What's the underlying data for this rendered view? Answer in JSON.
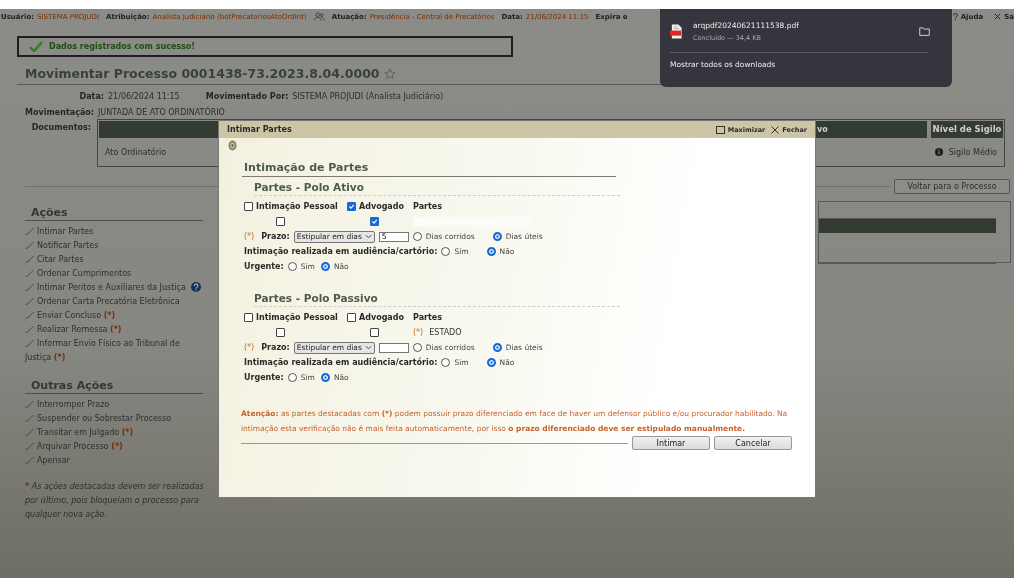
{
  "top_bar": {
    "fields": [
      {
        "label": "Usuário:",
        "value": "SISTEMA PROJUDI"
      },
      {
        "label": "Atribuição:",
        "value": "Analista Judiciário (botPrecatoriosAtoOrdInt)",
        "icon": true
      },
      {
        "label": "Atuação:",
        "value": "Presidência - Central de Precatórios"
      },
      {
        "label": "Data:",
        "value": "21/06/2024 11:15"
      },
      {
        "label": "Expira e"
      }
    ],
    "help": "Ajuda",
    "exit": "Sa"
  },
  "success_message": "Dados registrados com sucesso!",
  "page_title": "Movimentar Processo 0001438-73.2023.8.04.0000",
  "info": [
    {
      "label": "Data:",
      "value": "21/06/2024 11:15"
    },
    {
      "label": "Movimentado Por:",
      "value": "SISTEMA PROJUDI (Analista Judiciário)"
    }
  ],
  "movimentacao": {
    "label": "Movimentação:",
    "value": "JUNTADA DE ATO ORDINATÓRIO"
  },
  "documents": {
    "label": "Documentos:",
    "columns": [
      "vo",
      "Nível de Sigilo"
    ],
    "rows": [
      {
        "name": "Ato Ordinatório",
        "secrecy": "Sigilo Médio"
      }
    ]
  },
  "back_button": "Voltar para o Processo",
  "actions": {
    "title": "Ações",
    "items": [
      {
        "label": "Intimar Partes"
      },
      {
        "label": "Notificar Partes"
      },
      {
        "label": "Citar Partes"
      },
      {
        "label": "Ordenar Cumprimentos"
      },
      {
        "label": "Intimar Peritos e Auxiliares da Justiça",
        "help": true
      },
      {
        "label": "Ordenar Carta Precatória Eletrônica"
      },
      {
        "label": "Enviar Concluso",
        "mark": "(*)"
      },
      {
        "label": "Realizar Remessa",
        "mark": "(*)"
      },
      {
        "label": "Informar Envio Físico ao Tribunal de Justiça",
        "mark": "(*)"
      }
    ]
  },
  "other_actions": {
    "title": "Outras Ações",
    "items": [
      {
        "label": "Interromper Prazo"
      },
      {
        "label": "Suspender ou Sobrestar Processo"
      },
      {
        "label": "Transitar em Julgado",
        "mark": "(*)"
      },
      {
        "label": "Arquivar Processo",
        "mark": "(*)"
      },
      {
        "label": "Apensar"
      }
    ]
  },
  "note": {
    "mark": "*",
    "text": "As ações destacadas devem ser realizadas por último, pois bloqueiam o processo para qualquer nova ação."
  },
  "dialog": {
    "title": "Intimar Partes",
    "maximize": "Maximizar",
    "close": "Fechar",
    "heading": "Intimação de Partes",
    "sections": [
      {
        "title": "Partes - Polo Ativo",
        "personal": {
          "label": "Intimação Pessoal",
          "checked": false
        },
        "lawyer": {
          "label": "Advogado",
          "checked": true
        },
        "parties_label": "Partes",
        "row": {
          "personal_checked": false,
          "lawyer_checked": true,
          "party": {
            "kind": "redacted"
          }
        },
        "prazo": {
          "mark": "(*)",
          "label": "Prazo:",
          "select": "Estipular em dias",
          "value": "5",
          "options": [
            {
              "label": "Dias corridos",
              "selected": false
            },
            {
              "label": "Dias úteis",
              "selected": true
            }
          ]
        },
        "audiencia": {
          "label": "Intimação realizada em audiência/cartório:",
          "options": [
            {
              "label": "Sim",
              "selected": false
            },
            {
              "label": "Não",
              "selected": true
            }
          ]
        },
        "urgente": {
          "label": "Urgente:",
          "options": [
            {
              "label": "Sim",
              "selected": false
            },
            {
              "label": "Não",
              "selected": true
            }
          ]
        }
      },
      {
        "title": "Partes - Polo Passivo",
        "personal": {
          "label": "Intimação Pessoal",
          "checked": false
        },
        "lawyer": {
          "label": "Advogado",
          "checked": false
        },
        "parties_label": "Partes",
        "row": {
          "personal_checked": false,
          "lawyer_checked": false,
          "party": {
            "kind": "text",
            "mark": "(*)",
            "name": "ESTADO"
          }
        },
        "prazo": {
          "mark": "(*)",
          "label": "Prazo:",
          "select": "Estipular em dias",
          "options": [
            {
              "label": "Dias corridos",
              "selected": false
            },
            {
              "label": "Dias úteis",
              "selected": true
            }
          ]
        },
        "audiencia": {
          "label": "Intimação realizada em audiência/cartório:",
          "options": [
            {
              "label": "Sim",
              "selected": false
            },
            {
              "label": "Não",
              "selected": true
            }
          ]
        },
        "urgente": {
          "label": "Urgente:",
          "options": [
            {
              "label": "Sim",
              "selected": false
            },
            {
              "label": "Não",
              "selected": true
            }
          ]
        }
      }
    ],
    "warning": [
      {
        "text": "Atenção:",
        "bold": true
      },
      {
        "text": "as partes destacadas com",
        "bold": false
      },
      {
        "text": "(*)",
        "bold": true
      },
      {
        "text": "podem possuir prazo diferenciado em face de haver um defensor público e/ou procurador habilitado. Na intimação esta verificação não é mais feita automaticamente, por isso",
        "bold": false
      },
      {
        "text": "o prazo diferenciado deve ser estipulado manualmente.",
        "bold": true
      }
    ],
    "buttons": [
      "Intimar",
      "Cancelar"
    ]
  },
  "download": {
    "file": "arqpdf20240621111538.pdf",
    "status": "Concluído — 34,4 KB",
    "show_all": "Mostrar todos os downloads"
  }
}
